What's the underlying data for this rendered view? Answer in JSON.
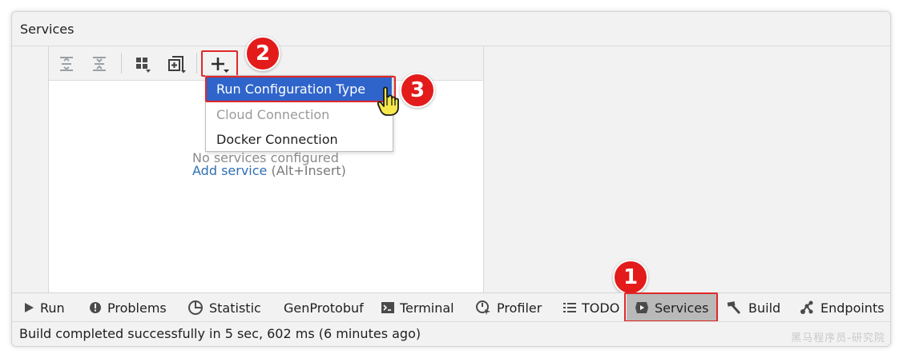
{
  "window": {
    "title": "Services"
  },
  "toolbar": {
    "icons": [
      "expand-all-icon",
      "collapse-all-icon",
      "group-by-icon",
      "new-tab-icon",
      "add-icon"
    ]
  },
  "panel": {
    "empty_text": "No services configured",
    "add_service_link": "Add service",
    "add_service_hint": "(Alt+Insert)"
  },
  "popup": {
    "items": [
      {
        "label": "Run Configuration Type",
        "selected": true,
        "enabled": true
      },
      {
        "label": "Cloud Connection",
        "selected": false,
        "enabled": false
      },
      {
        "label": "Docker Connection",
        "selected": false,
        "enabled": true
      }
    ]
  },
  "steps": {
    "one": "1",
    "two": "2",
    "three": "3"
  },
  "tool_tabs": [
    {
      "label": "Run",
      "icon": "play-icon"
    },
    {
      "label": "Problems",
      "icon": "info-icon"
    },
    {
      "label": "Statistic",
      "icon": "pie-chart-icon"
    },
    {
      "label": "GenProtobuf",
      "icon": ""
    },
    {
      "label": "Terminal",
      "icon": "terminal-icon"
    },
    {
      "label": "Profiler",
      "icon": "profiler-icon"
    },
    {
      "label": "TODO",
      "icon": "list-icon"
    },
    {
      "label": "Services",
      "icon": "services-icon",
      "active": true
    },
    {
      "label": "Build",
      "icon": "hammer-icon"
    },
    {
      "label": "Endpoints",
      "icon": "endpoints-icon"
    }
  ],
  "status": {
    "text": "Build completed successfully in 5 sec, 602 ms (6 minutes ago)"
  },
  "watermark": "黑马程序员-研究院",
  "colors": {
    "accent": "#2f65ca",
    "highlight": "#e02828",
    "badge": "#e31b1b",
    "link": "#2f6fb3"
  }
}
